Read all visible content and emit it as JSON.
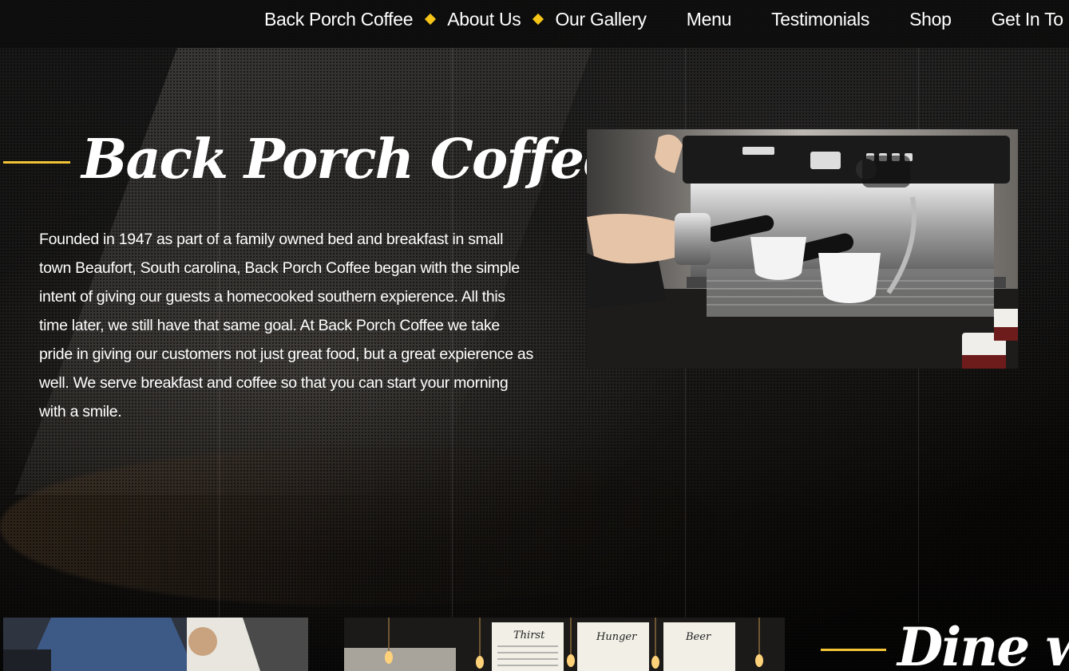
{
  "nav": {
    "items": [
      {
        "label": "Back Porch Coffee"
      },
      {
        "label": "About Us"
      },
      {
        "label": "Our Gallery"
      },
      {
        "label": "Menu"
      },
      {
        "label": "Testimonials"
      },
      {
        "label": "Shop"
      },
      {
        "label": "Get In To"
      }
    ]
  },
  "hero": {
    "title": "Back Porch Coffee",
    "body": "Founded in 1947 as part of a family owned bed and breakfast in small town Beaufort, South carolina, Back Porch Coffee began with the simple intent of giving our guests a homecooked southern expierence. All this time later, we still have that same goal. At Back Porch Coffee we take pride in giving our customers not just great food, but a great expierence as well. We serve breakfast and coffee so that you can start your morning with a smile."
  },
  "dine": {
    "title": "Dine wi"
  },
  "menu_board": {
    "thirst": "Thirst",
    "hunger": "Hunger",
    "beer": "Beer"
  },
  "colors": {
    "accent": "#f2c335",
    "nav_background": "#0c0c0c",
    "text": "#ffffff"
  }
}
